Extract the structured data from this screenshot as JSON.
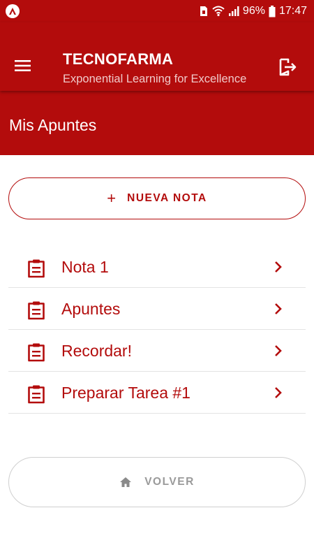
{
  "status_bar": {
    "battery": "96%",
    "time": "17:47",
    "icons": [
      "app-logo-icon",
      "sim-icon",
      "wifi-icon",
      "signal-icon",
      "battery-icon"
    ]
  },
  "app_bar": {
    "title": "TECNOFARMA",
    "subtitle": "Exponential Learning for Excellence",
    "icons": [
      "hamburger-menu-icon",
      "logout-icon"
    ]
  },
  "page": {
    "title": "Mis Apuntes"
  },
  "new_note_button": {
    "icon": "plus-icon",
    "label": "NUEVA NOTA"
  },
  "notes": [
    {
      "label": "Nota 1",
      "icon": "clipboard-icon"
    },
    {
      "label": "Apuntes",
      "icon": "clipboard-icon"
    },
    {
      "label": "Recordar!",
      "icon": "clipboard-icon"
    },
    {
      "label": "Preparar Tarea #1",
      "icon": "clipboard-icon"
    }
  ],
  "back_button": {
    "icon": "home-icon",
    "label": "VOLVER"
  },
  "colors": {
    "primary": "#b30c0c",
    "divider": "#e3e3e3",
    "muted": "#9a9a9a"
  }
}
